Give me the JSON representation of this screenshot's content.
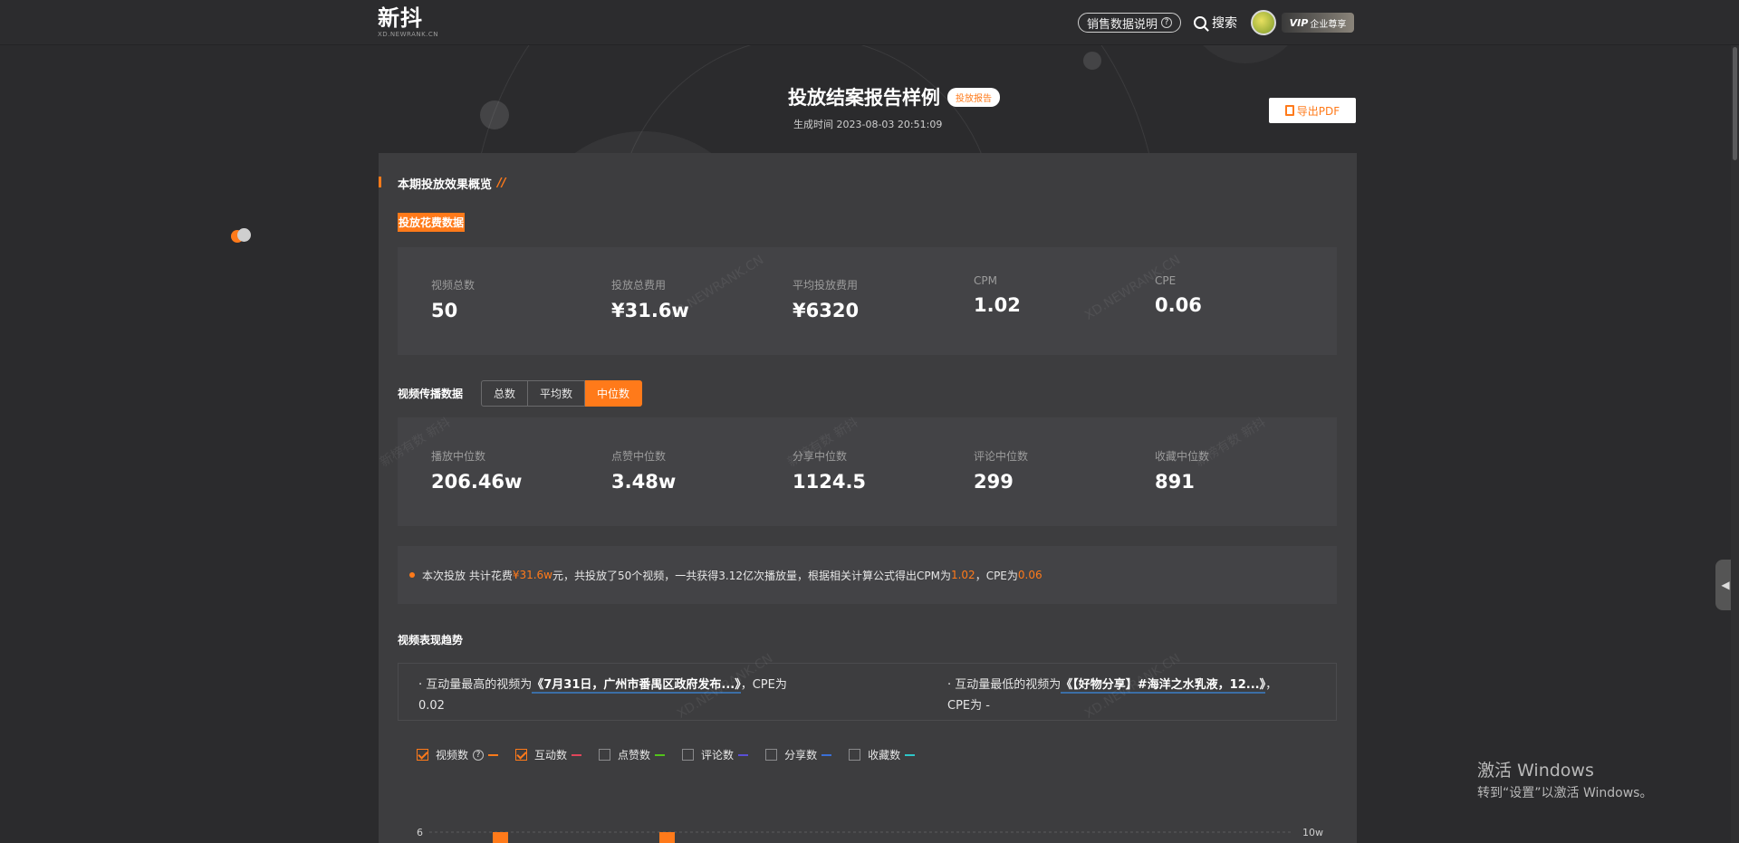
{
  "nav": {
    "logo": "新抖",
    "logo_sub": "XD.NEWRANK.CN",
    "sales_help": "销售数据说明",
    "help_glyph": "?",
    "search": "搜索",
    "vip_badge": "VIP",
    "vip_label": "企业尊享"
  },
  "header": {
    "title": "投放结案报告样例",
    "tag": "投放报告",
    "generated": "生成时间 2023-08-03 20:51:09",
    "export_label": "导出PDF"
  },
  "overview": {
    "title": "本期投放效果概览",
    "slash": "//",
    "cost_section": "投放花费数据",
    "cost_metrics": [
      {
        "label": "视频总数",
        "value": "50"
      },
      {
        "label": "投放总费用",
        "value": "¥31.6w"
      },
      {
        "label": "平均投放费用",
        "value": "¥6320"
      },
      {
        "label": "CPM",
        "value": "1.02"
      },
      {
        "label": "CPE",
        "value": "0.06"
      }
    ]
  },
  "spread": {
    "label": "视频传播数据",
    "tabs": [
      "总数",
      "平均数",
      "中位数"
    ],
    "active_tab": "中位数",
    "metrics": [
      {
        "label": "播放中位数",
        "value": "206.46w"
      },
      {
        "label": "点赞中位数",
        "value": "3.48w"
      },
      {
        "label": "分享中位数",
        "value": "1124.5"
      },
      {
        "label": "评论中位数",
        "value": "299"
      },
      {
        "label": "收藏中位数",
        "value": "891"
      }
    ]
  },
  "summary": {
    "p1": "本次投放 共计花费 ",
    "cost": "¥31.6w",
    "p2": " 元，共投放了50个视频，一共获得3.12亿次播放量，根据相关计算公式得出CPM为 ",
    "cpm": "1.02",
    "p3": "，CPE为 ",
    "cpe": "0.06"
  },
  "trend": {
    "title": "视频表现趋势",
    "highest_prefix": "· 互动量最高的视频为",
    "highest_link": "《7月31日，广州市番禺区政府发布...》",
    "highest_suffix": "，CPE为",
    "highest_cpe": "0.02",
    "lowest_prefix": "· 互动量最低的视频为",
    "lowest_link": "《【好物分享】#海洋之水乳液，12...》",
    "lowest_suffix": "，",
    "lowest_cpe": "CPE为 -"
  },
  "legend": [
    {
      "label": "视频数",
      "checked": true,
      "color": "#ff7a1a",
      "has_help": true
    },
    {
      "label": "互动数",
      "checked": true,
      "color": "#e0455a",
      "has_help": false
    },
    {
      "label": "点赞数",
      "checked": false,
      "color": "#52c41a",
      "has_help": false
    },
    {
      "label": "评论数",
      "checked": false,
      "color": "#5a4fd6",
      "has_help": false
    },
    {
      "label": "分享数",
      "checked": false,
      "color": "#3a6fd6",
      "has_help": false
    },
    {
      "label": "收藏数",
      "checked": false,
      "color": "#2ec7c9",
      "has_help": false
    }
  ],
  "chart_data": {
    "type": "bar",
    "y_left_top_tick": "6",
    "y_right_top_tick": "10w",
    "bars_visible_at_top_edge": 2,
    "bar_color": "#ff7a1a"
  },
  "watermark": "新榜有数 新抖",
  "watermark_url": "XD.NEWRANK.CN",
  "os_notice": {
    "line1": "激活 Windows",
    "line2": "转到“设置”以激活 Windows。"
  },
  "side_tab_glyph": "◀"
}
